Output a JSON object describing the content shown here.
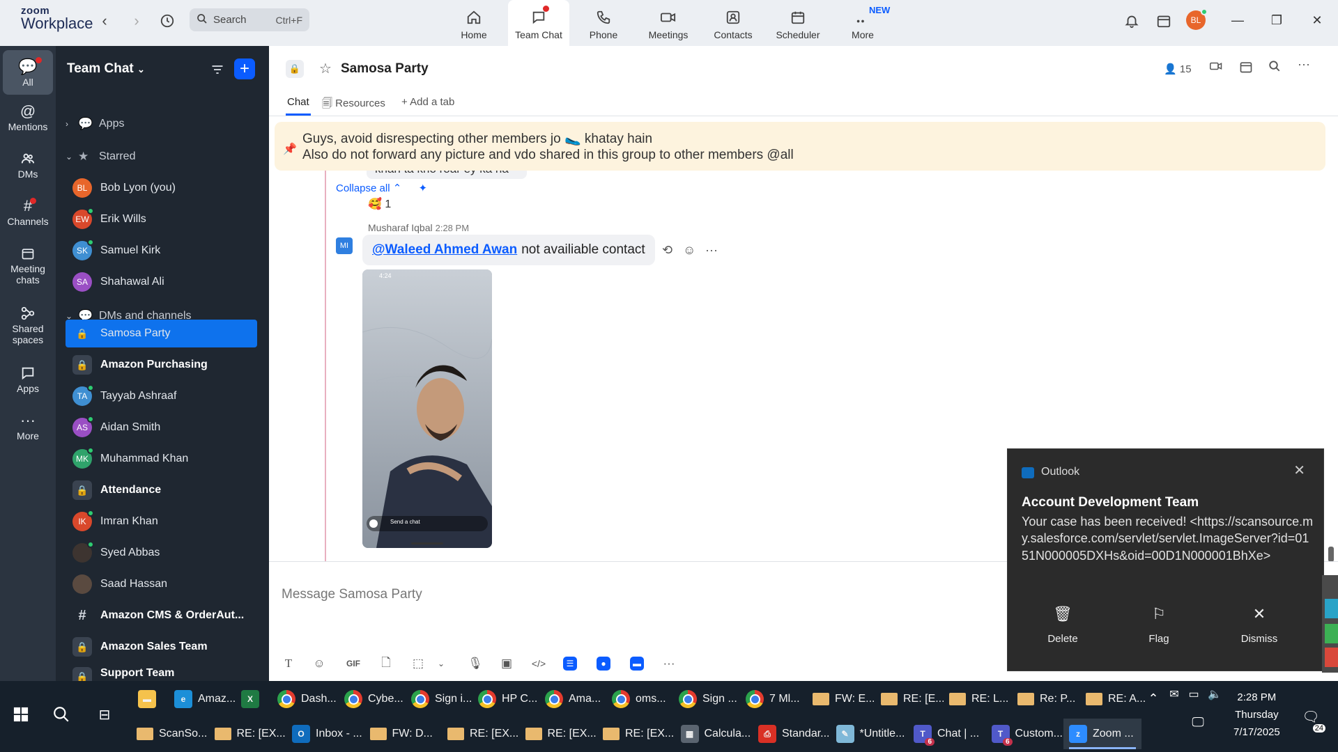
{
  "app": {
    "logo_line1": "zoom",
    "logo_line2": "Workplace",
    "search_placeholder": "Search",
    "search_shortcut": "Ctrl+F",
    "nav": [
      {
        "label": "Home",
        "icon": "home-icon"
      },
      {
        "label": "Team Chat",
        "icon": "chat-icon"
      },
      {
        "label": "Phone",
        "icon": "phone-icon"
      },
      {
        "label": "Meetings",
        "icon": "video-icon"
      },
      {
        "label": "Contacts",
        "icon": "contacts-icon"
      },
      {
        "label": "Scheduler",
        "icon": "calendar-icon"
      },
      {
        "label": "More",
        "icon": "more-icon"
      }
    ],
    "new_badge": "NEW",
    "user_initials": "BL",
    "accent": "#0b5cff"
  },
  "rail": {
    "items": [
      {
        "label": "All",
        "icon": "chat-bubble-icon"
      },
      {
        "label": "Mentions",
        "icon": "at-icon"
      },
      {
        "label": "DMs",
        "icon": "people-icon"
      },
      {
        "label": "Channels",
        "icon": "hash-icon"
      },
      {
        "label": "Meeting chats",
        "icon": "calendar-icon"
      },
      {
        "label": "Shared spaces",
        "icon": "shared-icon"
      },
      {
        "label": "Apps",
        "icon": "apps-icon"
      },
      {
        "label": "More",
        "icon": "ellipsis-icon"
      }
    ]
  },
  "sidebar": {
    "title": "Team Chat",
    "apps_label": "Apps",
    "starred_label": "Starred",
    "starred": [
      {
        "name": "Bob Lyon (you)",
        "initials": "BL",
        "color": "#e8662b"
      },
      {
        "name": "Erik Wills",
        "initials": "EW",
        "color": "#d9482b"
      },
      {
        "name": "Samuel Kirk",
        "initials": "SK",
        "color": "#3f8fd2"
      },
      {
        "name": "Shahawal Ali",
        "initials": "SA",
        "color": "#9a4fc4"
      }
    ],
    "dms_label": "DMs and channels",
    "items": [
      {
        "name": "Samosa Party",
        "kind": "lock"
      },
      {
        "name": "Amazon Purchasing",
        "kind": "lock"
      },
      {
        "name": "Tayyab Ashraaf",
        "initials": "TA",
        "color": "#3f8fd2"
      },
      {
        "name": "Aidan Smith",
        "initials": "AS",
        "color": "#9a4fc4"
      },
      {
        "name": "Muhammad Khan",
        "initials": "MK",
        "color": "#2fa36b"
      },
      {
        "name": "Attendance",
        "kind": "lock"
      },
      {
        "name": "Imran Khan",
        "initials": "IK",
        "color": "#d9482b"
      },
      {
        "name": "Syed Abbas",
        "initials": "",
        "color": "#3d3430"
      },
      {
        "name": "Saad Hassan",
        "initials": "",
        "color": "#5a4a40"
      },
      {
        "name": "Amazon CMS & OrderAut...",
        "kind": "hash"
      },
      {
        "name": "Amazon Sales Team",
        "kind": "lock"
      },
      {
        "name": "Support Team",
        "kind": "lock"
      }
    ]
  },
  "channel": {
    "name": "Samosa Party",
    "member_count": "15",
    "tabs": [
      "Chat",
      "Resources",
      "Add a tab"
    ]
  },
  "messages": {
    "pinned_line1": "Guys, avoid disrespecting other members jo 🥿 khatay hain",
    "pinned_line2": "Also do not forward any picture and vdo shared in this group to other members @all",
    "prev_bubble": "khan ta kho roar ey ka na",
    "collapse_label": "Collapse all",
    "reaction": "🥰 1",
    "sender": "Musharaf Iqbal",
    "time": "2:28 PM",
    "avatar_initials": "MI",
    "mention": "@Waleed Ahmed Awan",
    "text": "not availiable contact",
    "photo_time": "4:24",
    "photo_caption": "Send a chat"
  },
  "composer": {
    "placeholder": "Message Samosa Party",
    "gif_label": "GIF"
  },
  "toast": {
    "app": "Outlook",
    "title": "Account Development Team",
    "body": "Your case has been received! <https://scansource.my.salesforce.com/servlet/servlet.ImageServer?id=0151N000005DXHs&oid=00D1N000001BhXe>",
    "actions": [
      "Delete",
      "Flag",
      "Dismiss"
    ]
  },
  "taskbar": {
    "row1": [
      {
        "label": "",
        "kind": "folder"
      },
      {
        "label": "Amaz...",
        "kind": "edge"
      },
      {
        "label": "",
        "kind": "excel"
      },
      {
        "label": "Dash...",
        "kind": "chrome"
      },
      {
        "label": "Cybe...",
        "kind": "chrome"
      },
      {
        "label": "Sign i...",
        "kind": "chrome"
      },
      {
        "label": "HP C...",
        "kind": "chrome"
      },
      {
        "label": "Ama...",
        "kind": "chrome"
      },
      {
        "label": "oms...",
        "kind": "chrome"
      },
      {
        "label": "Sign ...",
        "kind": "chrome"
      },
      {
        "label": "7 Ml...",
        "kind": "chrome"
      },
      {
        "label": "FW: E...",
        "kind": "mail"
      },
      {
        "label": "RE: [E...",
        "kind": "mail"
      },
      {
        "label": "RE: L...",
        "kind": "mail"
      },
      {
        "label": "Re: P...",
        "kind": "mail"
      },
      {
        "label": "RE: A...",
        "kind": "mail"
      }
    ],
    "row2": [
      {
        "label": "ScanSo...",
        "kind": "mail"
      },
      {
        "label": "RE: [EX...",
        "kind": "mail"
      },
      {
        "label": "Inbox - ...",
        "kind": "outlook"
      },
      {
        "label": "FW: D...",
        "kind": "mail"
      },
      {
        "label": "RE: [EX...",
        "kind": "mail"
      },
      {
        "label": "RE: [EX...",
        "kind": "mail"
      },
      {
        "label": "RE: [EX...",
        "kind": "mail"
      },
      {
        "label": "Calcula...",
        "kind": "calc"
      },
      {
        "label": "Standar...",
        "kind": "pdf"
      },
      {
        "label": "*Untitle...",
        "kind": "paint"
      },
      {
        "label": "Chat | ...",
        "kind": "teams",
        "badge": "6"
      },
      {
        "label": "Custom...",
        "kind": "teams",
        "badge": "6"
      },
      {
        "label": "Zoom ...",
        "kind": "zoom"
      }
    ],
    "time": "2:28 PM",
    "day": "Thursday",
    "date": "7/17/2025",
    "notif_count": "24"
  }
}
